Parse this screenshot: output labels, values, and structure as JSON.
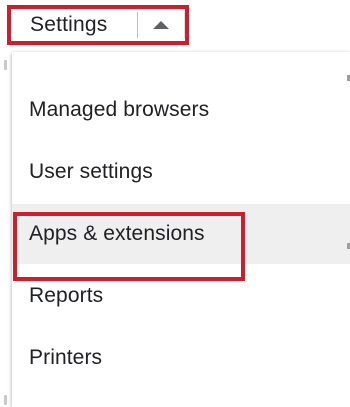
{
  "settings_menu": {
    "label": "Settings",
    "toggle_icon": "caret-up-icon"
  },
  "menu": {
    "items": [
      {
        "label": "Managed browsers"
      },
      {
        "label": "User settings"
      },
      {
        "label": "Apps & extensions",
        "hovered": true
      },
      {
        "label": "Reports"
      },
      {
        "label": "Printers"
      }
    ]
  },
  "colors": {
    "highlight": "#cc1f2d",
    "hover_bg": "#efefef",
    "text": "#202124"
  }
}
